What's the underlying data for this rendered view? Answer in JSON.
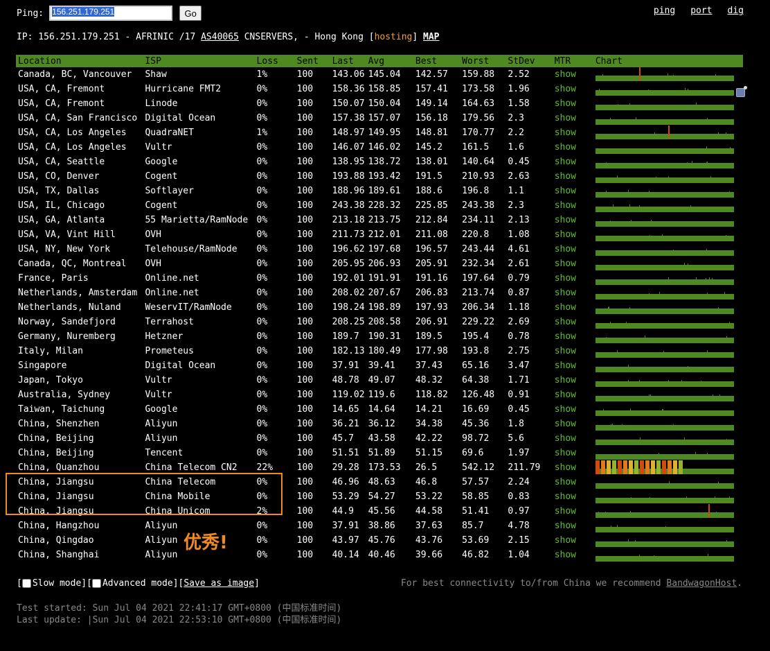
{
  "ping": {
    "label": "Ping:",
    "value": "156.251.179.251",
    "go_label": "Go"
  },
  "top_links": [
    "ping",
    "port",
    "dig"
  ],
  "ip_info": {
    "prefix": "IP: 156.251.179.251 - AFRINIC /17 ",
    "asn": "AS40065",
    "mid": " CNSERVERS, - Hong Kong [",
    "hosting": "hosting",
    "close": "] ",
    "map": "MAP"
  },
  "table": {
    "headers": [
      "Location",
      "ISP",
      "Loss",
      "Sent",
      "Last",
      "Avg",
      "Best",
      "Worst",
      "StDev",
      "MTR",
      "Chart"
    ],
    "rows": [
      [
        "Canada, BC, Vancouver",
        "Shaw",
        "1%",
        "100",
        "143.06",
        "145.04",
        "142.57",
        "159.88",
        "2.52",
        "show"
      ],
      [
        "USA, CA, Fremont",
        "Hurricane FMT2",
        "0%",
        "100",
        "158.36",
        "158.85",
        "157.41",
        "173.58",
        "1.96",
        "show"
      ],
      [
        "USA, CA, Fremont",
        "Linode",
        "0%",
        "100",
        "150.07",
        "150.04",
        "149.14",
        "164.63",
        "1.58",
        "show"
      ],
      [
        "USA, CA, San Francisco",
        "Digital Ocean",
        "0%",
        "100",
        "157.38",
        "157.07",
        "156.18",
        "179.56",
        "2.3",
        "show"
      ],
      [
        "USA, CA, Los Angeles",
        "QuadraNET",
        "1%",
        "100",
        "148.97",
        "149.95",
        "148.81",
        "170.77",
        "2.2",
        "show"
      ],
      [
        "USA, CA, Los Angeles",
        "Vultr",
        "0%",
        "100",
        "146.07",
        "146.02",
        "145.2",
        "161.5",
        "1.6",
        "show"
      ],
      [
        "USA, CA, Seattle",
        "Google",
        "0%",
        "100",
        "138.95",
        "138.72",
        "138.01",
        "140.64",
        "0.45",
        "show"
      ],
      [
        "USA, CO, Denver",
        "Cogent",
        "0%",
        "100",
        "193.88",
        "193.42",
        "191.5",
        "210.93",
        "2.63",
        "show"
      ],
      [
        "USA, TX, Dallas",
        "Softlayer",
        "0%",
        "100",
        "188.96",
        "189.61",
        "188.6",
        "196.8",
        "1.1",
        "show"
      ],
      [
        "USA, IL, Chicago",
        "Cogent",
        "0%",
        "100",
        "243.38",
        "228.32",
        "225.85",
        "243.38",
        "2.3",
        "show"
      ],
      [
        "USA, GA, Atlanta",
        "55 Marietta/RamNode",
        "0%",
        "100",
        "213.18",
        "213.75",
        "212.84",
        "234.11",
        "2.13",
        "show"
      ],
      [
        "USA, VA, Vint Hill",
        "OVH",
        "0%",
        "100",
        "211.73",
        "212.01",
        "211.08",
        "220.8",
        "1.08",
        "show"
      ],
      [
        "USA, NY, New York",
        "Telehouse/RamNode",
        "0%",
        "100",
        "196.62",
        "197.68",
        "196.57",
        "243.44",
        "4.61",
        "show"
      ],
      [
        "Canada, QC, Montreal",
        "OVH",
        "0%",
        "100",
        "205.95",
        "206.93",
        "205.91",
        "232.34",
        "2.61",
        "show"
      ],
      [
        "France, Paris",
        "Online.net",
        "0%",
        "100",
        "192.01",
        "191.91",
        "191.16",
        "197.64",
        "0.79",
        "show"
      ],
      [
        "Netherlands, Amsterdam",
        "Online.net",
        "0%",
        "100",
        "208.02",
        "207.67",
        "206.83",
        "213.74",
        "0.87",
        "show"
      ],
      [
        "Netherlands, Nuland",
        "WeservIT/RamNode",
        "0%",
        "100",
        "198.24",
        "198.89",
        "197.93",
        "206.34",
        "1.18",
        "show"
      ],
      [
        "Norway, Sandefjord",
        "Terrahost",
        "0%",
        "100",
        "208.25",
        "208.58",
        "206.91",
        "229.22",
        "2.69",
        "show"
      ],
      [
        "Germany, Nuremberg",
        "Hetzner",
        "0%",
        "100",
        "189.7",
        "190.31",
        "189.5",
        "195.4",
        "0.78",
        "show"
      ],
      [
        "Italy, Milan",
        "Prometeus",
        "0%",
        "100",
        "182.13",
        "180.49",
        "177.98",
        "193.8",
        "2.75",
        "show"
      ],
      [
        "Singapore",
        "Digital Ocean",
        "0%",
        "100",
        "37.91",
        "39.41",
        "37.43",
        "65.16",
        "3.47",
        "show"
      ],
      [
        "Japan, Tokyo",
        "Vultr",
        "0%",
        "100",
        "48.78",
        "49.07",
        "48.32",
        "64.38",
        "1.71",
        "show"
      ],
      [
        "Australia, Sydney",
        "Vultr",
        "0%",
        "100",
        "119.02",
        "119.6",
        "118.82",
        "126.48",
        "0.91",
        "show"
      ],
      [
        "Taiwan, Taichung",
        "Google",
        "0%",
        "100",
        "14.65",
        "14.64",
        "14.21",
        "16.69",
        "0.45",
        "show"
      ],
      [
        "China, Shenzhen",
        "Aliyun",
        "0%",
        "100",
        "36.21",
        "36.12",
        "34.38",
        "45.36",
        "1.8",
        "show"
      ],
      [
        "China, Beijing",
        "Aliyun",
        "0%",
        "100",
        "45.7",
        "43.58",
        "42.22",
        "98.72",
        "5.6",
        "show"
      ],
      [
        "China, Beijing",
        "Tencent",
        "0%",
        "100",
        "51.51",
        "51.89",
        "51.15",
        "69.6",
        "1.97",
        "show"
      ],
      [
        "China, Quanzhou",
        "China Telecom CN2",
        "22%",
        "100",
        "29.28",
        "173.53",
        "26.5",
        "542.12",
        "211.79",
        "show"
      ],
      [
        "China, Jiangsu",
        "China Telecom",
        "0%",
        "100",
        "46.96",
        "48.63",
        "46.8",
        "57.57",
        "2.24",
        "show"
      ],
      [
        "China, Jiangsu",
        "China Mobile",
        "0%",
        "100",
        "53.29",
        "54.27",
        "53.22",
        "58.85",
        "0.83",
        "show"
      ],
      [
        "China, Jiangsu",
        "China Unicom",
        "2%",
        "100",
        "44.9",
        "45.56",
        "44.58",
        "51.41",
        "0.97",
        "show"
      ],
      [
        "China, Hangzhou",
        "Aliyun",
        "0%",
        "100",
        "37.91",
        "38.86",
        "37.63",
        "85.7",
        "4.78",
        "show"
      ],
      [
        "China, Qingdao",
        "Aliyun",
        "0%",
        "100",
        "43.97",
        "45.76",
        "43.76",
        "53.69",
        "2.15",
        "show"
      ],
      [
        "China, Shanghai",
        "Aliyun",
        "0%",
        "100",
        "40.14",
        "40.46",
        "39.66",
        "46.82",
        "1.04",
        "show"
      ]
    ]
  },
  "annotation": "优秀!",
  "modes": {
    "slow_mode": "Slow mode",
    "advanced_mode": "Advanced mode",
    "save_image": "Save as image"
  },
  "recommend": {
    "text": "For best connectivity to/from China we recommend ",
    "link": "BandwagonHost",
    "end": "."
  },
  "times": {
    "started": "Test started: Sun Jul 04 2021 22:41:17 GMT+0800 (中国标准时间)",
    "updated": "Last update: |Sun Jul 04 2021 22:53:10 GMT+0800 (中国标准时间)"
  },
  "colors": {
    "accent_green": "#4e8a21",
    "link_green": "#5fbf2a",
    "annotation_orange": "#f08a24",
    "loss_red": "#d24a12"
  }
}
